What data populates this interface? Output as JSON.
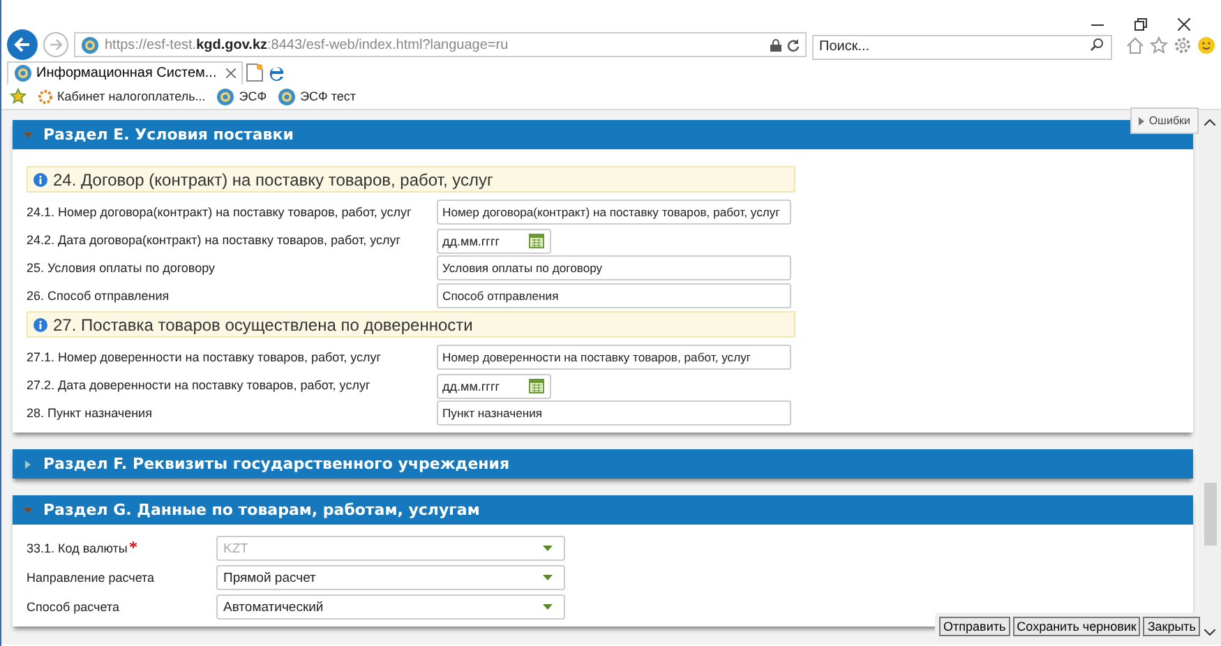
{
  "address_bar": {
    "url": "https://esf-test.**kgd.gov.kz**:8443/esf-web/index.html?language=ru"
  },
  "search": {
    "placeholder": "Поиск..."
  },
  "tabs": [
    {
      "label": "Информационная Систем...",
      "selected": true
    }
  ],
  "favorites": [
    "Кабинет налогоплатель...",
    "ЭСФ",
    "ЭСФ тест"
  ],
  "errors_button": "Ошибки",
  "sections": [
    {
      "title": "Раздел E. Условия поставки",
      "expanded": true,
      "groups": [
        {
          "title": "24. Договор (контракт) на поставку товаров, работ, услуг",
          "fields": [
            {
              "label": "24.1. Номер договора(контракт) на поставку товаров, работ, услуг",
              "kind": "text",
              "placeholder": "Номер договора(контракт) на поставку товаров, работ, услуг"
            },
            {
              "label": "24.2. Дата договора(контракт) на поставку товаров, работ, услуг",
              "kind": "date",
              "placeholder": "дд.мм.гггг"
            },
            {
              "label": "25. Условия оплаты по договору",
              "kind": "text",
              "placeholder": "Условия оплаты по договору"
            },
            {
              "label": "26. Способ отправления",
              "kind": "text",
              "placeholder": "Способ отправления"
            }
          ]
        },
        {
          "title": "27. Поставка товаров осуществлена по доверенности",
          "fields": [
            {
              "label": "27.1. Номер доверенности на поставку товаров, работ, услуг",
              "kind": "text",
              "placeholder": "Номер доверенности на поставку товаров, работ, услуг"
            },
            {
              "label": "27.2. Дата доверенности на поставку товаров, работ, услуг",
              "kind": "date",
              "placeholder": "дд.мм.гггг"
            },
            {
              "label": "28. Пункт назначения",
              "kind": "text",
              "placeholder": "Пункт назначения"
            }
          ]
        }
      ]
    },
    {
      "title": "Раздел F. Реквизиты государственного учреждения",
      "expanded": false
    },
    {
      "title": "Раздел G. Данные по товарам, работам, услугам",
      "expanded": true,
      "groups": [
        {
          "fields": [
            {
              "label": "33.1. Код валюты",
              "required": true,
              "kind": "select",
              "value": "KZT",
              "disabled": true
            },
            {
              "label": "Направление расчета",
              "required": false,
              "kind": "select",
              "value": "Прямой расчет",
              "disabled": false
            },
            {
              "label": "Способ расчета",
              "required": false,
              "kind": "select",
              "value": "Автоматический",
              "disabled": false
            }
          ]
        }
      ]
    }
  ],
  "actions": [
    "Отправить",
    "Сохранить черновик",
    "Закрыть"
  ]
}
